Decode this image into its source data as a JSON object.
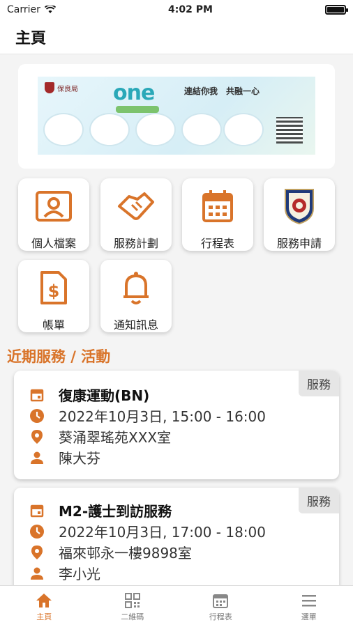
{
  "status_bar": {
    "carrier": "Carrier",
    "time": "4:02 PM"
  },
  "header": {
    "title": "主頁"
  },
  "banner": {
    "org": "保良局",
    "brand": "one",
    "slogan": "連結你我　共融一心"
  },
  "tiles": [
    {
      "label": "個人檔案"
    },
    {
      "label": "服務計劃"
    },
    {
      "label": "行程表"
    },
    {
      "label": "服務申請"
    },
    {
      "label": "帳單"
    },
    {
      "label": "通知訊息"
    }
  ],
  "section": {
    "title": "近期服務 / 活動"
  },
  "cards": [
    {
      "badge": "服務",
      "title": "復康運動(BN)",
      "datetime": "2022年10月3日, 15:00 - 16:00",
      "location": "葵涌翠瑤苑XXX室",
      "person": "陳大芬"
    },
    {
      "badge": "服務",
      "title": "M2-護士到訪服務",
      "datetime": "2022年10月3日, 17:00 - 18:00",
      "location": "福來邨永一樓9898室",
      "person": "李小光"
    }
  ],
  "tabbar": {
    "items": [
      {
        "label": "主頁",
        "icon": "home-icon"
      },
      {
        "label": "二維碼",
        "icon": "qr-code-icon"
      },
      {
        "label": "行程表",
        "icon": "calendar-icon"
      },
      {
        "label": "選單",
        "icon": "menu-icon"
      }
    ]
  },
  "colors": {
    "accent": "#d9742a",
    "background": "#f4f4f4"
  }
}
